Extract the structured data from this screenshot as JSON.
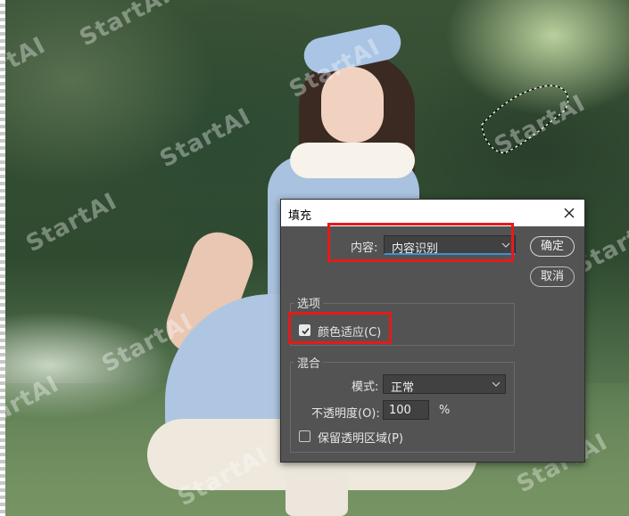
{
  "watermark": {
    "text": "StartAI"
  },
  "dialog": {
    "title": "填充",
    "content": {
      "label": "内容:",
      "value": "内容识别"
    },
    "buttons": {
      "ok": "确定",
      "cancel": "取消"
    },
    "options": {
      "title": "选项",
      "color_adapt": {
        "label": "颜色适应(C)",
        "checked": true
      }
    },
    "blend": {
      "title": "混合",
      "mode": {
        "label": "模式:",
        "value": "正常"
      },
      "opacity": {
        "label": "不透明度(O):",
        "value": "100",
        "unit": "%"
      },
      "preserve_transparency": {
        "label": "保留透明区域(P)",
        "checked": false
      }
    }
  },
  "icons": {
    "close": "close-icon",
    "dropdown": "chevron-down-icon",
    "check": "checkmark-icon"
  },
  "colors": {
    "highlight": "#e51a1a",
    "dialog_bg": "#535353",
    "focus": "#3d8fd9"
  }
}
